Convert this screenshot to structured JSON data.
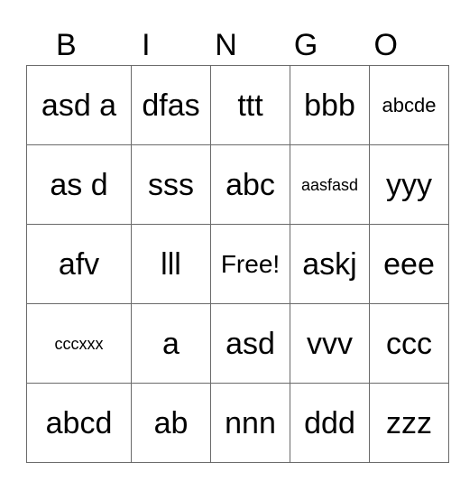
{
  "header": [
    "B",
    "I",
    "N",
    "G",
    "O"
  ],
  "cells": [
    [
      "asd a",
      "dfas",
      "ttt",
      "bbb",
      "abcde"
    ],
    [
      "as d",
      "sss",
      "abc",
      "aasfasd",
      "yyy"
    ],
    [
      "afv",
      "lll",
      "Free!",
      "askj",
      "eee"
    ],
    [
      "cccxxx",
      "a",
      "asd",
      "vvv",
      "ccc"
    ],
    [
      "abcd",
      "ab",
      "nnn",
      "ddd",
      "zzz"
    ]
  ]
}
